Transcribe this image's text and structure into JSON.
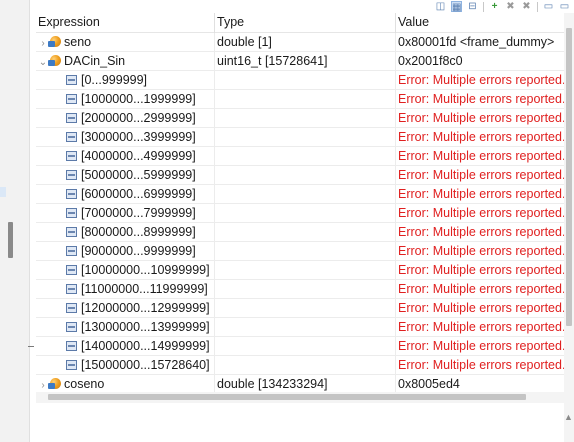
{
  "columns": {
    "expression": "Expression",
    "type": "Type",
    "value": "Value"
  },
  "rows": [
    {
      "expr": "seno",
      "type": "double [1]",
      "value": "0x80001fd <frame_dummy>",
      "expander": "›",
      "icon": "variable",
      "indent": 0,
      "error": false
    },
    {
      "expr": "DACin_Sin",
      "type": "uint16_t [15728641]",
      "value": "0x2001f8c0",
      "expander": "⌄",
      "icon": "variable",
      "indent": 0,
      "error": false
    },
    {
      "expr": "[0...999999]",
      "type": "",
      "value": "Error: Multiple errors reported.",
      "expander": "",
      "icon": "array",
      "indent": 1,
      "error": true
    },
    {
      "expr": "[1000000...1999999]",
      "type": "",
      "value": "Error: Multiple errors reported.",
      "expander": "",
      "icon": "array",
      "indent": 1,
      "error": true
    },
    {
      "expr": "[2000000...2999999]",
      "type": "",
      "value": "Error: Multiple errors reported.",
      "expander": "",
      "icon": "array",
      "indent": 1,
      "error": true
    },
    {
      "expr": "[3000000...3999999]",
      "type": "",
      "value": "Error: Multiple errors reported.",
      "expander": "",
      "icon": "array",
      "indent": 1,
      "error": true
    },
    {
      "expr": "[4000000...4999999]",
      "type": "",
      "value": "Error: Multiple errors reported.",
      "expander": "",
      "icon": "array",
      "indent": 1,
      "error": true
    },
    {
      "expr": "[5000000...5999999]",
      "type": "",
      "value": "Error: Multiple errors reported.",
      "expander": "",
      "icon": "array",
      "indent": 1,
      "error": true
    },
    {
      "expr": "[6000000...6999999]",
      "type": "",
      "value": "Error: Multiple errors reported.",
      "expander": "",
      "icon": "array",
      "indent": 1,
      "error": true
    },
    {
      "expr": "[7000000...7999999]",
      "type": "",
      "value": "Error: Multiple errors reported.",
      "expander": "",
      "icon": "array",
      "indent": 1,
      "error": true
    },
    {
      "expr": "[8000000...8999999]",
      "type": "",
      "value": "Error: Multiple errors reported.",
      "expander": "",
      "icon": "array",
      "indent": 1,
      "error": true
    },
    {
      "expr": "[9000000...9999999]",
      "type": "",
      "value": "Error: Multiple errors reported.",
      "expander": "",
      "icon": "array",
      "indent": 1,
      "error": true
    },
    {
      "expr": "[10000000...10999999]",
      "type": "",
      "value": "Error: Multiple errors reported.",
      "expander": "",
      "icon": "array",
      "indent": 1,
      "error": true
    },
    {
      "expr": "[11000000...11999999]",
      "type": "",
      "value": "Error: Multiple errors reported.",
      "expander": "",
      "icon": "array",
      "indent": 1,
      "error": true
    },
    {
      "expr": "[12000000...12999999]",
      "type": "",
      "value": "Error: Multiple errors reported.",
      "expander": "",
      "icon": "array",
      "indent": 1,
      "error": true
    },
    {
      "expr": "[13000000...13999999]",
      "type": "",
      "value": "Error: Multiple errors reported.",
      "expander": "",
      "icon": "array",
      "indent": 1,
      "error": true
    },
    {
      "expr": "[14000000...14999999]",
      "type": "",
      "value": "Error: Multiple errors reported.",
      "expander": "",
      "icon": "array",
      "indent": 1,
      "error": true
    },
    {
      "expr": "[15000000...15728640]",
      "type": "",
      "value": "Error: Multiple errors reported.",
      "expander": "",
      "icon": "array",
      "indent": 1,
      "error": true
    },
    {
      "expr": "coseno",
      "type": "double [134233294]",
      "value": "0x8005ed4",
      "expander": "›",
      "icon": "variable",
      "indent": 0,
      "error": false
    }
  ],
  "toolbar": [
    {
      "name": "show-type-names-icon",
      "glyph": "◫",
      "cls": ""
    },
    {
      "name": "show-logical-structure-icon",
      "glyph": "▦",
      "cls": "sel"
    },
    {
      "name": "collapse-all-icon",
      "glyph": "⊟",
      "cls": ""
    },
    {
      "name": "add-expression-icon",
      "glyph": "+",
      "cls": "green"
    },
    {
      "name": "remove-expression-icon",
      "glyph": "✖",
      "cls": "grey"
    },
    {
      "name": "remove-all-icon",
      "glyph": "✖",
      "cls": "grey"
    },
    {
      "name": "view-menu-icon",
      "glyph": "▭",
      "cls": ""
    },
    {
      "name": "minimize-icon",
      "glyph": "▭",
      "cls": ""
    }
  ],
  "colors": {
    "error": "#e02020",
    "header_border": "#e6e6e6",
    "scroll_thumb": "#c4c4c4"
  }
}
